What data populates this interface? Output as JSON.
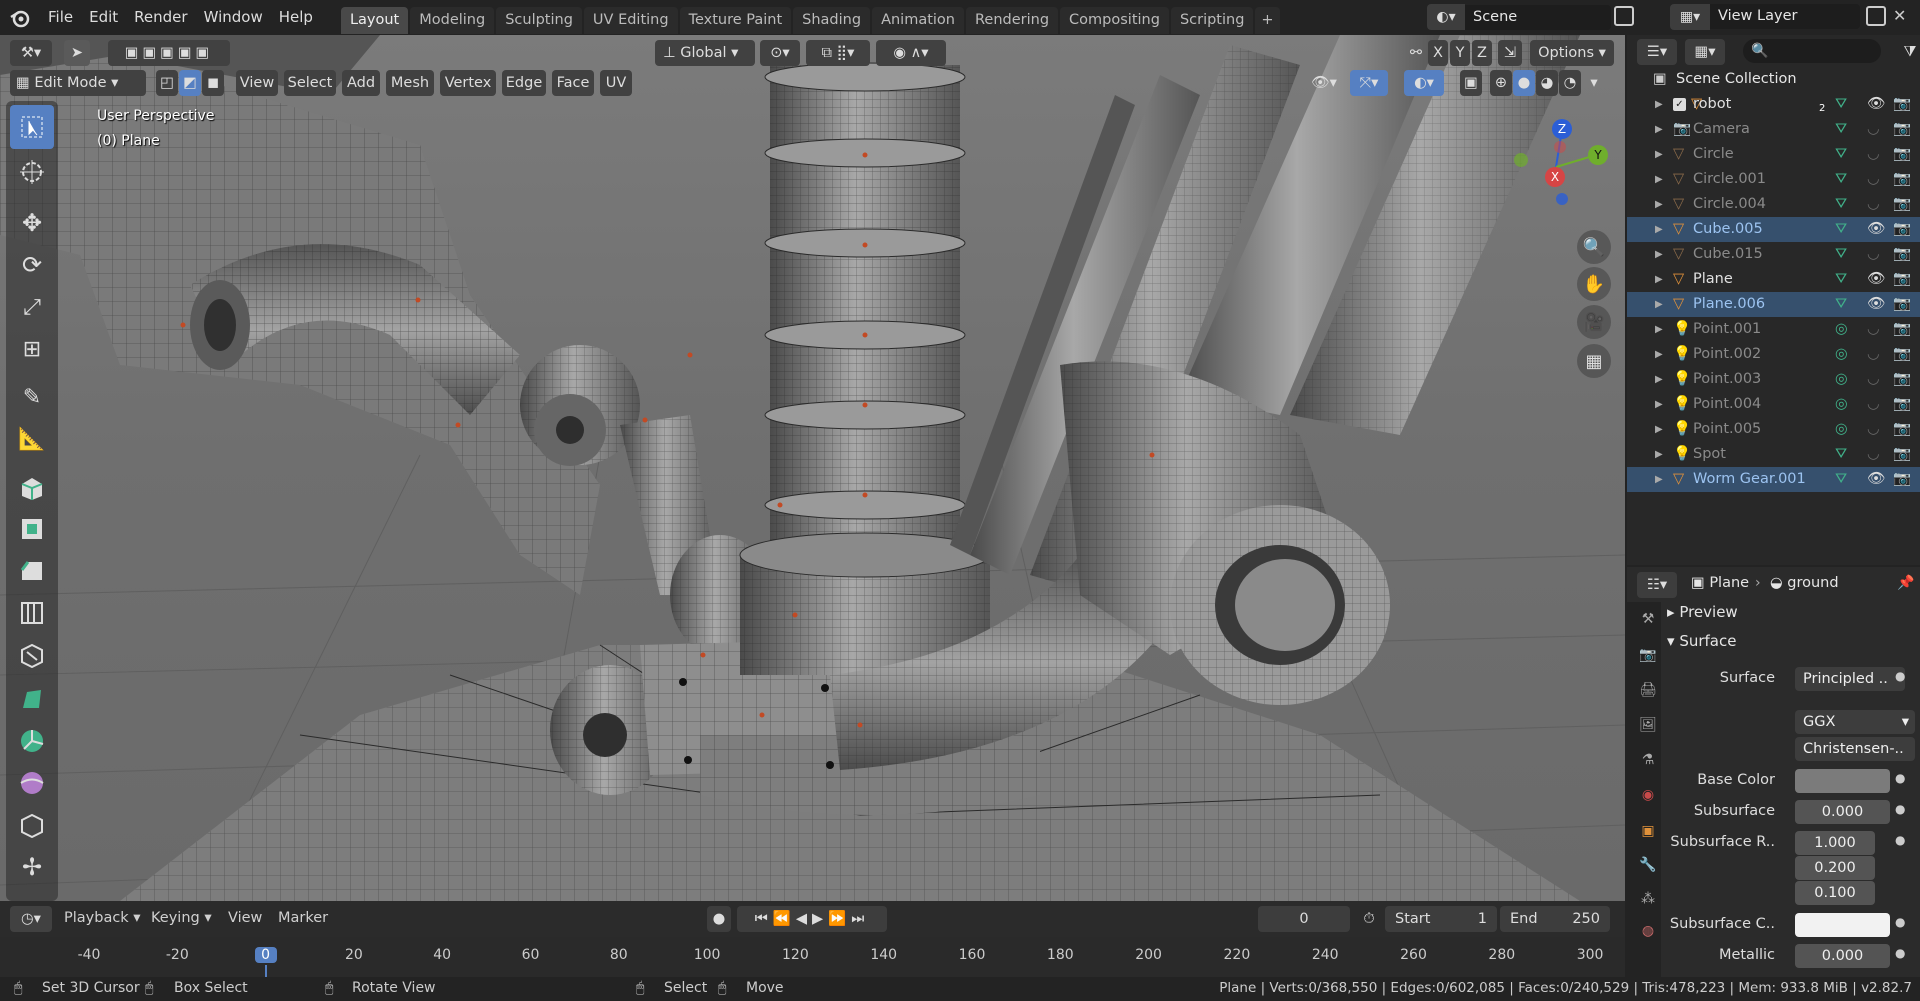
{
  "menus": [
    "File",
    "Edit",
    "Render",
    "Window",
    "Help"
  ],
  "workspaces": [
    "Layout",
    "Modeling",
    "Sculpting",
    "UV Editing",
    "Texture Paint",
    "Shading",
    "Animation",
    "Rendering",
    "Compositing",
    "Scripting"
  ],
  "active_workspace": "Layout",
  "scene_name": "Scene",
  "view_layer": "View Layer",
  "header": {
    "orientation": "Global",
    "options": "Options",
    "axes": [
      "X",
      "Y",
      "Z"
    ],
    "mode": "Edit Mode",
    "menus": [
      "View",
      "Select",
      "Add",
      "Mesh",
      "Vertex",
      "Edge",
      "Face",
      "UV"
    ]
  },
  "viewport": {
    "perspective": "User Perspective",
    "object": "(0) Plane",
    "gizmo": {
      "x": "X",
      "y": "Y",
      "z": "Z"
    }
  },
  "timeline": {
    "menus": [
      "Playback",
      "Keying",
      "View",
      "Marker"
    ],
    "current_frame": "0",
    "start_label": "Start",
    "start": "1",
    "end_label": "End",
    "end": "250",
    "ruler": [
      "-40",
      "-20",
      "0",
      "20",
      "40",
      "60",
      "80",
      "100",
      "120",
      "140",
      "160",
      "180",
      "200",
      "220",
      "240",
      "260",
      "280",
      "300"
    ]
  },
  "outliner": {
    "collection": "Scene Collection",
    "items": [
      {
        "name": "robot",
        "selected": false,
        "faded": false
      },
      {
        "name": "Camera",
        "selected": false,
        "faded": true
      },
      {
        "name": "Circle",
        "selected": false,
        "faded": true
      },
      {
        "name": "Circle.001",
        "selected": false,
        "faded": true
      },
      {
        "name": "Circle.004",
        "selected": false,
        "faded": true
      },
      {
        "name": "Cube.005",
        "selected": true,
        "faded": false
      },
      {
        "name": "Cube.015",
        "selected": false,
        "faded": true
      },
      {
        "name": "Plane",
        "selected": false,
        "faded": false
      },
      {
        "name": "Plane.006",
        "selected": true,
        "faded": false
      },
      {
        "name": "Point.001",
        "selected": false,
        "faded": true
      },
      {
        "name": "Point.002",
        "selected": false,
        "faded": true
      },
      {
        "name": "Point.003",
        "selected": false,
        "faded": true
      },
      {
        "name": "Point.004",
        "selected": false,
        "faded": true
      },
      {
        "name": "Point.005",
        "selected": false,
        "faded": true
      },
      {
        "name": "Spot",
        "selected": false,
        "faded": true
      },
      {
        "name": "Worm Gear.001",
        "selected": true,
        "faded": false
      }
    ],
    "robot_badge": "2"
  },
  "properties": {
    "object": "Plane",
    "material": "ground",
    "preview": "Preview",
    "surface_panel": "Surface",
    "surface_label": "Surface",
    "surface_value": "Principled ..",
    "distribution": "GGX",
    "subsurface_method": "Christensen-..",
    "base_color_label": "Base Color",
    "subsurface_label": "Subsurface",
    "subsurface_value": "0.000",
    "subsurface_r_label": "Subsurface R..",
    "subsurface_r": [
      "1.000",
      "0.200",
      "0.100"
    ],
    "subsurface_c_label": "Subsurface C..",
    "metallic_label": "Metallic",
    "metallic_value": "0.000"
  },
  "status": {
    "hints": [
      "Set 3D Cursor",
      "Box Select",
      "Rotate View",
      "Select",
      "Move"
    ],
    "stats": "Plane | Verts:0/368,550 | Edges:0/602,085 | Faces:0/240,529 | Tris:478,223 | Mem: 933.8 MiB | v2.82.7"
  },
  "colors": {
    "accent": "#5680c2",
    "selected_row": "#36506d",
    "object_orange": "#e0913a",
    "mesh_green": "#41b28a"
  }
}
